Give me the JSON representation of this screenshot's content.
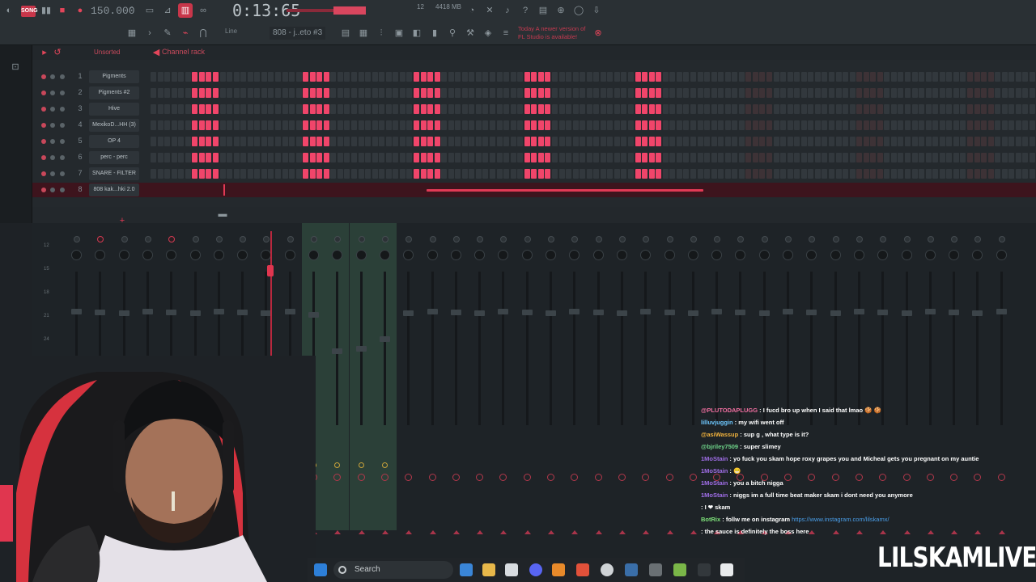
{
  "toolbar": {
    "song_mode": "SONG",
    "tempo": "150.000",
    "time": "0:13:65",
    "time_label": "M:S:CS",
    "pattern_number": "12",
    "memory": "4418 MB",
    "memory_small": "0",
    "pattern_select": "808 - j..eto #3",
    "snap_label": "Line",
    "news_line1": "Today  A newer version of",
    "news_line2": "FL Studio is available!"
  },
  "channel_rack": {
    "title": "Channel rack",
    "filter": "Unsorted",
    "channels": [
      {
        "num": "1",
        "name": "Pigments"
      },
      {
        "num": "2",
        "name": "Pigments #2"
      },
      {
        "num": "3",
        "name": "Hive"
      },
      {
        "num": "4",
        "name": "MexikoD...HH (3)"
      },
      {
        "num": "5",
        "name": "OP 4"
      },
      {
        "num": "6",
        "name": "perc - perc"
      },
      {
        "num": "7",
        "name": "SNARE - FILTER"
      },
      {
        "num": "8",
        "name": "808 kak...hki 2.0"
      }
    ]
  },
  "mixer": {
    "db_marks": [
      "12",
      "15",
      "18",
      "21",
      "24",
      "27",
      "30",
      "33"
    ],
    "strip_count": 41
  },
  "taskbar": {
    "search_placeholder": "Search"
  },
  "chat": [
    {
      "user": "@PLUTODAPLUGG",
      "user_color": "#f06fa0",
      "text": " : I fucd bro up when I said that lmao 🍪 🍪"
    },
    {
      "user": "lilluvjuggin",
      "user_color": "#6ec8ff",
      "text": " : my wifi went off"
    },
    {
      "user": "@asiWassup",
      "user_color": "#f2b33d",
      "text": " : sup g , what type is it?"
    },
    {
      "user": "@bjriley7509",
      "user_color": "#6fd58a",
      "text": " : super slimey"
    },
    {
      "user": "1MoStain",
      "user_color": "#a06ee8",
      "text": " : yo fuck you skam hope roxy grapes you and Micheal gets you pregnant on my auntie"
    },
    {
      "user": "1MoStain",
      "user_color": "#a06ee8",
      "text": " : 😁"
    },
    {
      "user": "1MoStain",
      "user_color": "#a06ee8",
      "text": " : you a bitch nigga"
    },
    {
      "user": "1MoStain",
      "user_color": "#a06ee8",
      "text": " : niggs im a full time beat maker skam i dont need you anymore"
    },
    {
      "user": "",
      "user_color": "#e0364f",
      "text": " : I ❤ skam"
    },
    {
      "user": "BotRix",
      "user_color": "#7ee27a",
      "text": " : follw me on instagram ",
      "link": "https://www.instagram.com/lilskamx/"
    },
    {
      "user": "",
      "user_color": "#e0364f",
      "text": " : the sauce is definitely the boss here"
    }
  ],
  "overlay": {
    "brand": "LILSKAMLIVE"
  },
  "colors": {
    "accent": "#f0456a",
    "bg": "#1e2226",
    "selected_strip": "#2b4038"
  }
}
